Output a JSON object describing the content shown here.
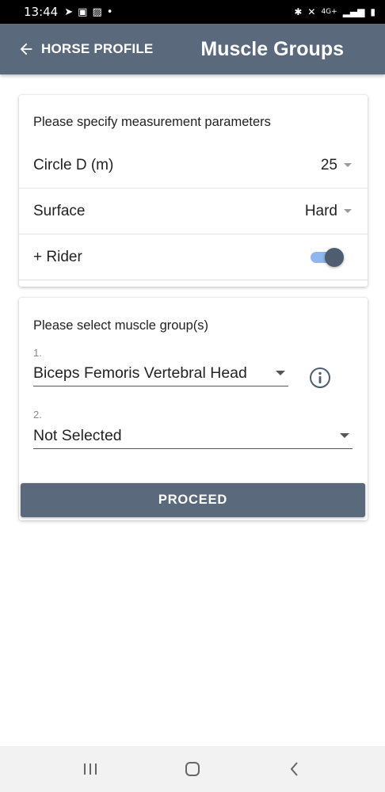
{
  "status_bar": {
    "time": "13:44",
    "network": "4G+"
  },
  "app_bar": {
    "back_label": "HORSE PROFILE",
    "title": "Muscle Groups"
  },
  "params_card": {
    "heading": "Please specify measurement parameters",
    "circle": {
      "label": "Circle D (m)",
      "value": "25"
    },
    "surface": {
      "label": "Surface",
      "value": "Hard"
    },
    "rider": {
      "label": "+ Rider",
      "enabled": true
    }
  },
  "muscle_card": {
    "heading": "Please select muscle group(s)",
    "fields": [
      {
        "number": "1.",
        "value": "Biceps Femoris Vertebral Head"
      },
      {
        "number": "2.",
        "value": "Not Selected"
      }
    ],
    "proceed_label": "PROCEED"
  },
  "colors": {
    "primary": "#5a6a7c",
    "toggle_track": "#8fb7ee",
    "toggle_thumb": "#4e5e70"
  }
}
